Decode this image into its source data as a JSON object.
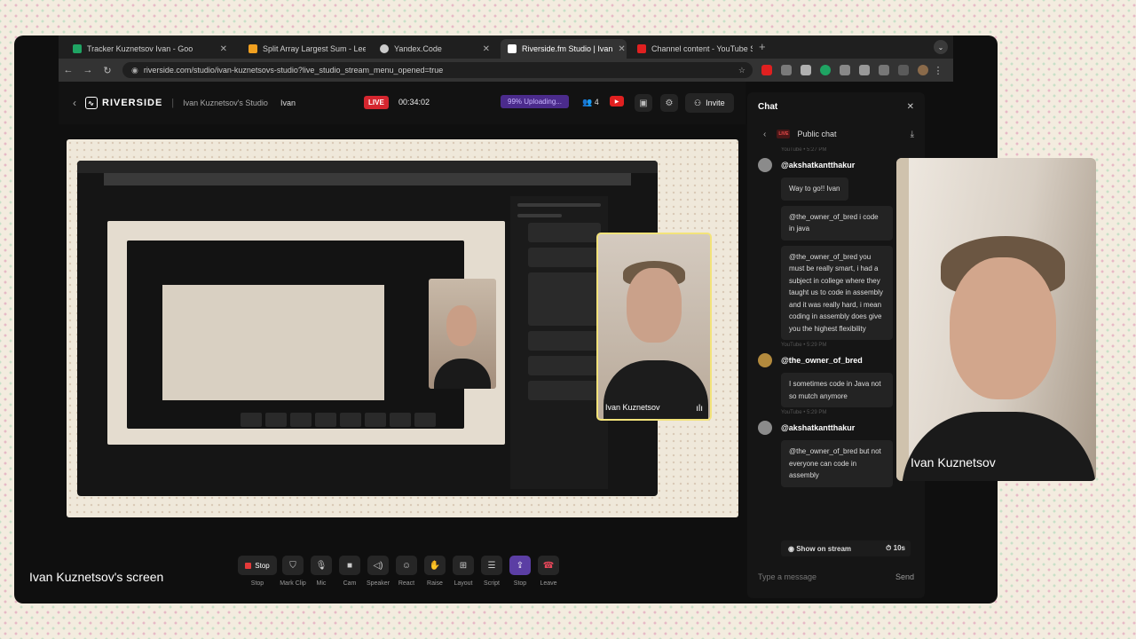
{
  "browser": {
    "tabs": [
      {
        "label": "Tracker Kuznetsov Ivan - Goo",
        "color": "#1fa463"
      },
      {
        "label": "Split Array Largest Sum - Lee",
        "color": "#f0a020"
      },
      {
        "label": "Yandex.Code",
        "color": "#cccccc"
      },
      {
        "label": "Riverside.fm Studio | Ivan",
        "color": "#ffffff"
      },
      {
        "label": "Channel content - YouTube S",
        "color": "#e02020"
      }
    ],
    "url": "riverside.com/studio/ivan-kuznetsovs-studio?live_studio_stream_menu_opened=true"
  },
  "studio": {
    "brand": "RIVERSIDE",
    "studio_name": "Ivan Kuznetsov's Studio",
    "user": "Ivan",
    "live": "LIVE",
    "timer": "00:34:02",
    "upload": "99% Uploading...",
    "guest_count": "4",
    "invite": "Invite"
  },
  "stage": {
    "camera_name": "Ivan Kuznetsov",
    "screen_label": "Ivan Kuznetsov's screen"
  },
  "controls": {
    "stop_btn": "Stop",
    "labels": [
      "Stop",
      "Mark Clip",
      "Mic",
      "Cam",
      "Speaker",
      "React",
      "Raise",
      "Layout",
      "Script",
      "Stop",
      "Leave"
    ]
  },
  "chat": {
    "title": "Chat",
    "live": "LIVE",
    "channel": "Public chat",
    "meta_top": "YouTube • 5:27 PM",
    "messages": [
      {
        "user": "@akshatkantthakur",
        "bubbles": [
          "Way to go!! Ivan",
          "@the_owner_of_bred i code in java",
          "@the_owner_of_bred you must be really smart, i had a subject in college where they taught us to code in assembly and it was really hard, i mean coding in assembly does give you the highest flexibility"
        ],
        "meta": "YouTube • 5:29 PM"
      },
      {
        "user": "@the_owner_of_bred",
        "bubbles": [
          "I sometimes code in Java not so mutch anymore"
        ],
        "meta": "YouTube • 5:29 PM"
      },
      {
        "user": "@akshatkantthakur",
        "bubbles": [
          "@the_owner_of_bred but not everyone can code in assembly"
        ],
        "meta": ""
      }
    ],
    "show_on_stream": "Show on stream",
    "timer": "10s",
    "placeholder": "Type a message",
    "send": "Send"
  },
  "camera": {
    "name": "Ivan Kuznetsov"
  }
}
